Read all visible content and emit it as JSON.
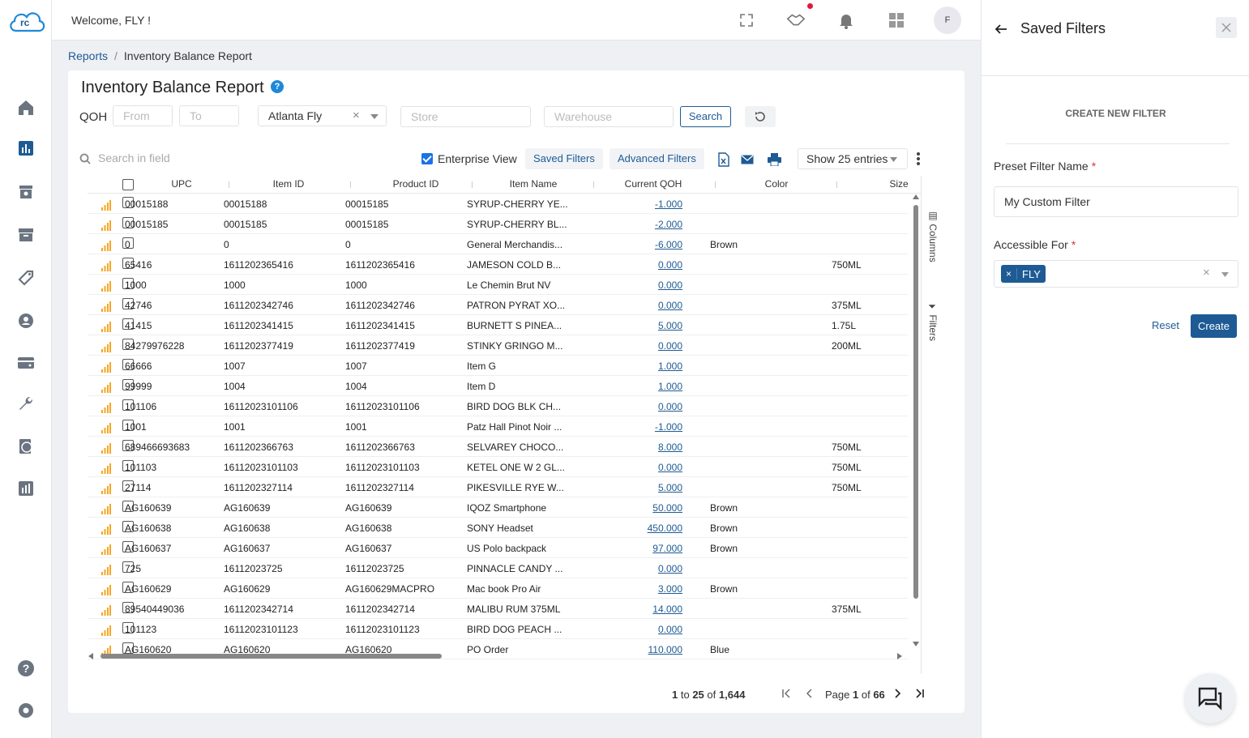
{
  "app": {
    "logo_text": "rc",
    "welcome": "Welcome, FLY !",
    "avatar_initial": "F"
  },
  "breadcrumb": {
    "parent": "Reports",
    "current": "Inventory Balance Report"
  },
  "report": {
    "title": "Inventory Balance Report",
    "help_glyph": "?",
    "qoh_label": "QOH",
    "qoh_from_placeholder": "From",
    "qoh_to_placeholder": "To",
    "location_value": "Atlanta Fly",
    "store_placeholder": "Store",
    "warehouse_placeholder": "Warehouse",
    "search_label": "Search",
    "search_field_placeholder": "Search in field",
    "enterprise_view_label": "Enterprise View",
    "saved_filters_label": "Saved Filters",
    "advanced_filters_label": "Advanced Filters",
    "show_entries": "Show 25 entries",
    "columns_tab": "Columns",
    "filters_tab": "Filters"
  },
  "table": {
    "columns": [
      "UPC",
      "Item ID",
      "Product ID",
      "Item Name",
      "Current QOH",
      "Color",
      "Size"
    ],
    "rows": [
      {
        "upc": "00015188",
        "item_id": "00015188",
        "product_id": "00015185",
        "name": "SYRUP-CHERRY YE...",
        "qoh": "-1.000",
        "color": "",
        "size": ""
      },
      {
        "upc": "00015185",
        "item_id": "00015185",
        "product_id": "00015185",
        "name": "SYRUP-CHERRY BL...",
        "qoh": "-2.000",
        "color": "",
        "size": ""
      },
      {
        "upc": "0",
        "item_id": "0",
        "product_id": "0",
        "name": "General Merchandis...",
        "qoh": "-6.000",
        "color": "Brown",
        "size": ""
      },
      {
        "upc": "65416",
        "item_id": "1611202365416",
        "product_id": "1611202365416",
        "name": "JAMESON COLD B...",
        "qoh": "0.000",
        "color": "",
        "size": "750ML"
      },
      {
        "upc": "1000",
        "item_id": "1000",
        "product_id": "1000",
        "name": "Le Chemin Brut NV",
        "qoh": "0.000",
        "color": "",
        "size": ""
      },
      {
        "upc": "42746",
        "item_id": "1611202342746",
        "product_id": "1611202342746",
        "name": "PATRON PYRAT XO...",
        "qoh": "0.000",
        "color": "",
        "size": "375ML"
      },
      {
        "upc": "41415",
        "item_id": "1611202341415",
        "product_id": "1611202341415",
        "name": "BURNETT S PINEA...",
        "qoh": "5.000",
        "color": "",
        "size": "1.75L"
      },
      {
        "upc": "84279976228",
        "item_id": "1611202377419",
        "product_id": "1611202377419",
        "name": "STINKY GRINGO M...",
        "qoh": "0.000",
        "color": "",
        "size": "200ML"
      },
      {
        "upc": "66666",
        "item_id": "1007",
        "product_id": "1007",
        "name": "Item G",
        "qoh": "1.000",
        "color": "",
        "size": ""
      },
      {
        "upc": "99999",
        "item_id": "1004",
        "product_id": "1004",
        "name": "Item D",
        "qoh": "1.000",
        "color": "",
        "size": ""
      },
      {
        "upc": "101106",
        "item_id": "16112023101106",
        "product_id": "16112023101106",
        "name": "BIRD DOG BLK CH...",
        "qoh": "0.000",
        "color": "",
        "size": ""
      },
      {
        "upc": "1001",
        "item_id": "1001",
        "product_id": "1001",
        "name": "Patz Hall Pinot Noir ...",
        "qoh": "-1.000",
        "color": "",
        "size": ""
      },
      {
        "upc": "689466693683",
        "item_id": "1611202366763",
        "product_id": "1611202366763",
        "name": "SELVAREY CHOCO...",
        "qoh": "8.000",
        "color": "",
        "size": "750ML"
      },
      {
        "upc": "101103",
        "item_id": "16112023101103",
        "product_id": "16112023101103",
        "name": "KETEL ONE W 2 GL...",
        "qoh": "0.000",
        "color": "",
        "size": "750ML"
      },
      {
        "upc": "27114",
        "item_id": "1611202327114",
        "product_id": "1611202327114",
        "name": "PIKESVILLE RYE W...",
        "qoh": "5.000",
        "color": "",
        "size": "750ML"
      },
      {
        "upc": "AG160639",
        "item_id": "AG160639",
        "product_id": "AG160639",
        "name": "IQOZ Smartphone",
        "qoh": "50.000",
        "color": "Brown",
        "size": ""
      },
      {
        "upc": "AG160638",
        "item_id": "AG160638",
        "product_id": "AG160638",
        "name": "SONY Headset",
        "qoh": "450.000",
        "color": "Brown",
        "size": ""
      },
      {
        "upc": "AG160637",
        "item_id": "AG160637",
        "product_id": "AG160637",
        "name": "US Polo backpack",
        "qoh": "97.000",
        "color": "Brown",
        "size": ""
      },
      {
        "upc": "725",
        "item_id": "16112023725",
        "product_id": "16112023725",
        "name": "PINNACLE CANDY ...",
        "qoh": "0.000",
        "color": "",
        "size": ""
      },
      {
        "upc": "AG160629",
        "item_id": "AG160629",
        "product_id": "AG160629MACPRO",
        "name": "Mac book Pro Air",
        "qoh": "3.000",
        "color": "Brown",
        "size": ""
      },
      {
        "upc": "89540449036",
        "item_id": "1611202342714",
        "product_id": "1611202342714",
        "name": "MALIBU RUM 375ML",
        "qoh": "14.000",
        "color": "",
        "size": "375ML"
      },
      {
        "upc": "101123",
        "item_id": "16112023101123",
        "product_id": "16112023101123",
        "name": "BIRD DOG PEACH ...",
        "qoh": "0.000",
        "color": "",
        "size": ""
      },
      {
        "upc": "AG160620",
        "item_id": "AG160620",
        "product_id": "AG160620",
        "name": "PO Order",
        "qoh": "110.000",
        "color": "Blue",
        "size": ""
      }
    ]
  },
  "pagination": {
    "from": "1",
    "to": "25",
    "total": "1,644",
    "page": "1",
    "pages": "66",
    "to_word": "to",
    "of_word": "of",
    "page_word": "Page"
  },
  "panel": {
    "title": "Saved Filters",
    "section_label": "CREATE NEW FILTER",
    "name_label": "Preset Filter Name",
    "name_value": "My Custom Filter",
    "access_label": "Accessible For",
    "access_chip": "FLY",
    "reset_label": "Reset",
    "create_label": "Create",
    "required_mark": "*"
  },
  "colors": {
    "accent": "#1e5b94",
    "bars": "#f5a623",
    "required": "#dd3333",
    "notify_dot": "#e3173e"
  }
}
